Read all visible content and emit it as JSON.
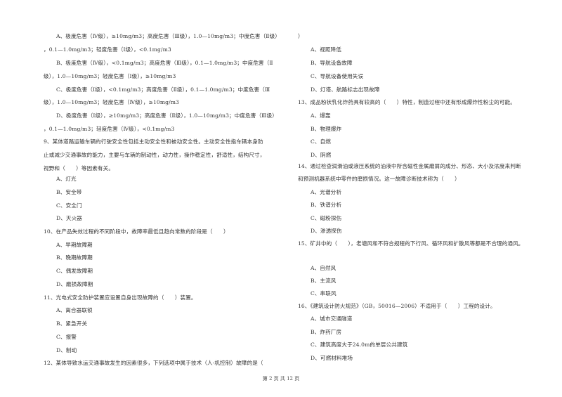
{
  "left_column": [
    {
      "type": "opt",
      "text": "A、极度危害（Ⅳ级），≥10mg/m3；高度危害（Ⅲ级），1.0—10mg/m3；中度危害（Ⅱ级）"
    },
    {
      "type": "cont",
      "text": "，0.1—1.0mg/m3；轻度危害（Ⅰ级），<0.1mg/m3"
    },
    {
      "type": "opt",
      "text": "B、极度危害（Ⅳ级），<0.1mg/m3；高度危害（Ⅲ级），0.1—1.0mg/m3；中度危害（Ⅱ"
    },
    {
      "type": "cont",
      "text": "级），1.0—10mg/m3；轻度危害（Ⅰ级），≥10mg/m3"
    },
    {
      "type": "opt",
      "text": "C、极度危害（Ⅰ级），<0.1mg/m3；高度危害（Ⅱ级），0.1—1.0mg/m3；中度危害（Ⅲ"
    },
    {
      "type": "cont",
      "text": "级），1.0—10mg/m3；轻度危害（Ⅳ级），≥10mg/m3"
    },
    {
      "type": "opt",
      "text": "D、极度危害（Ⅰ级），≥10mg/m3；高度危害（Ⅱ级），1.0—10mg/m3；中度危害（Ⅲ级）"
    },
    {
      "type": "cont",
      "text": "，0.1—1.0mg/m3；轻度危害（Ⅳ级），<0.1mg/m3"
    },
    {
      "type": "q",
      "text": "9、某体道路运输车辆的行驶安全性包括主动安全性和被动安全性。主动安全性指车辆本身防"
    },
    {
      "type": "cont",
      "text": "止或减少交通事故的能力，主要与车辆的制动性，动力性，操作稳定性，舒适性，结构尺寸，"
    },
    {
      "type": "cont",
      "text": "视野和（　　）等因素有关。"
    },
    {
      "type": "opt",
      "text": "A、灯光"
    },
    {
      "type": "opt",
      "text": "B、安全带"
    },
    {
      "type": "opt",
      "text": "C、安全门"
    },
    {
      "type": "opt",
      "text": "D、灭火器"
    },
    {
      "type": "q",
      "text": "10、在产品失效过程的不同阶段中，故障率最低且趋向常数的阶段是（　　）"
    },
    {
      "type": "opt",
      "text": "A、早期故障期"
    },
    {
      "type": "opt",
      "text": "B、晚期故障期"
    },
    {
      "type": "opt",
      "text": "C、偶发故障期"
    },
    {
      "type": "opt",
      "text": "D、磨损故障期"
    },
    {
      "type": "q",
      "text": "11、光电式安全防护装置应设置自身出现故障的（　　）装置。"
    },
    {
      "type": "opt",
      "text": "A、离合器联锁"
    },
    {
      "type": "opt",
      "text": "B、紧急开关"
    },
    {
      "type": "opt",
      "text": "C、报警"
    },
    {
      "type": "opt",
      "text": "D、制动"
    },
    {
      "type": "q",
      "text": "12、某体导致水运交通事故发生的因素很多，下列选项中属于技术（人-机控制）故障的是（"
    }
  ],
  "right_column": [
    {
      "type": "cont",
      "text": "）"
    },
    {
      "type": "opt",
      "text": "A、视距降低"
    },
    {
      "type": "opt",
      "text": "B、导航设备故障"
    },
    {
      "type": "opt",
      "text": "C、导航设备使用失误"
    },
    {
      "type": "opt",
      "text": "D、灯塔、航路标志出现故障"
    },
    {
      "type": "q",
      "text": "13、成品粉状乳化炸药具有较高的（　　）特性，制造过程中还有形成爆炸性粉尘的可能。"
    },
    {
      "type": "opt",
      "text": "A、爆轰"
    },
    {
      "type": "opt",
      "text": "B、物理爆炸"
    },
    {
      "type": "opt",
      "text": "C、自燃"
    },
    {
      "type": "opt",
      "text": "D、阴燃"
    },
    {
      "type": "q",
      "text": "14、通过检查润滑油或液压系统的油液中所含磁性金属磨屑的成分、形态、大小及浓度来判断"
    },
    {
      "type": "cont",
      "text": "和预测机器系统中零件的磨损情况。这一故障诊断技术称为（　　）"
    },
    {
      "type": "opt",
      "text": "A、光谱分析"
    },
    {
      "type": "opt",
      "text": "B、铁谱分析"
    },
    {
      "type": "opt",
      "text": "C、磁粉探伤"
    },
    {
      "type": "opt",
      "text": "D、渗透探伤"
    },
    {
      "type": "q",
      "text": "15、矿井中的（　　），老塘风和不符合规程的下行风、循环风和扩散风等都是不合理的通风。"
    },
    {
      "type": "opt",
      "text": "A、自然风"
    },
    {
      "type": "opt",
      "text": "B、主流风"
    },
    {
      "type": "opt",
      "text": "C、串联风"
    },
    {
      "type": "q",
      "text": "16、《建筑设计防火规范》（GB，50016—2006）不适用于（　　）工程的设计。"
    },
    {
      "type": "opt",
      "text": "A、城市交通隧道"
    },
    {
      "type": "opt",
      "text": "B、炸药厂房"
    },
    {
      "type": "opt",
      "text": "C、建筑高度大于24.0m的单层公共建筑"
    },
    {
      "type": "opt",
      "text": "D、可燃材料堆场"
    }
  ],
  "footer": {
    "page_label": "第 2 页 共 12 页"
  }
}
